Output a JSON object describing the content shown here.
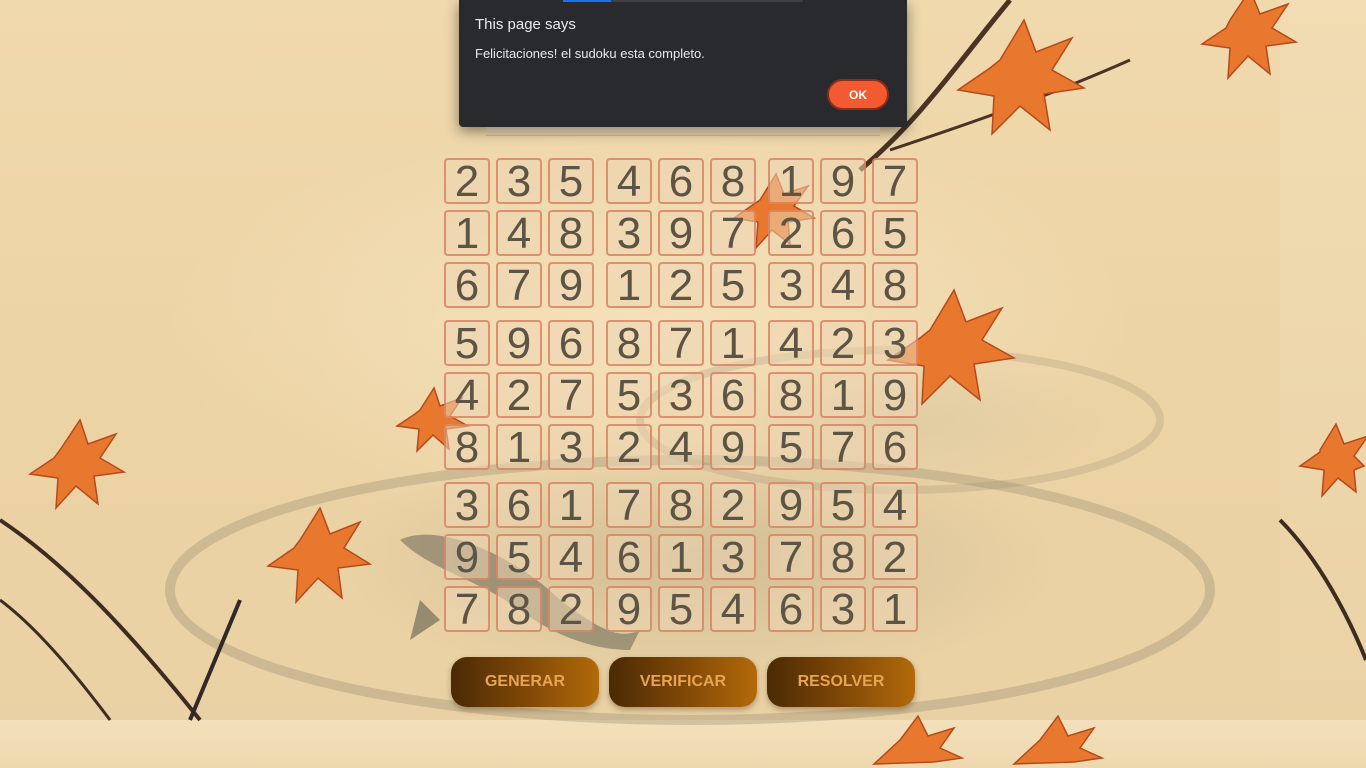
{
  "dialog": {
    "title": "This page says",
    "message": "Felicitaciones! el sudoku esta completo.",
    "ok_label": "OK"
  },
  "sudoku": {
    "rows": [
      [
        "2",
        "3",
        "5",
        "4",
        "6",
        "8",
        "1",
        "9",
        "7"
      ],
      [
        "1",
        "4",
        "8",
        "3",
        "9",
        "7",
        "2",
        "6",
        "5"
      ],
      [
        "6",
        "7",
        "9",
        "1",
        "2",
        "5",
        "3",
        "4",
        "8"
      ],
      [
        "5",
        "9",
        "6",
        "8",
        "7",
        "1",
        "4",
        "2",
        "3"
      ],
      [
        "4",
        "2",
        "7",
        "5",
        "3",
        "6",
        "8",
        "1",
        "9"
      ],
      [
        "8",
        "1",
        "3",
        "2",
        "4",
        "9",
        "5",
        "7",
        "6"
      ],
      [
        "3",
        "6",
        "1",
        "7",
        "8",
        "2",
        "9",
        "5",
        "4"
      ],
      [
        "9",
        "5",
        "4",
        "6",
        "1",
        "3",
        "7",
        "8",
        "2"
      ],
      [
        "7",
        "8",
        "2",
        "9",
        "5",
        "4",
        "6",
        "3",
        "1"
      ]
    ]
  },
  "buttons": {
    "generate": "GENERAR",
    "verify": "VERIFICAR",
    "solve": "RESOLVER"
  },
  "colors": {
    "dialog_bg": "#292a2d",
    "ok_button": "#f45a32",
    "cell_border": "#d6785a",
    "button_gradient_start": "#4a2a05",
    "button_gradient_end": "#b26a0a",
    "button_text": "#e7a453"
  }
}
